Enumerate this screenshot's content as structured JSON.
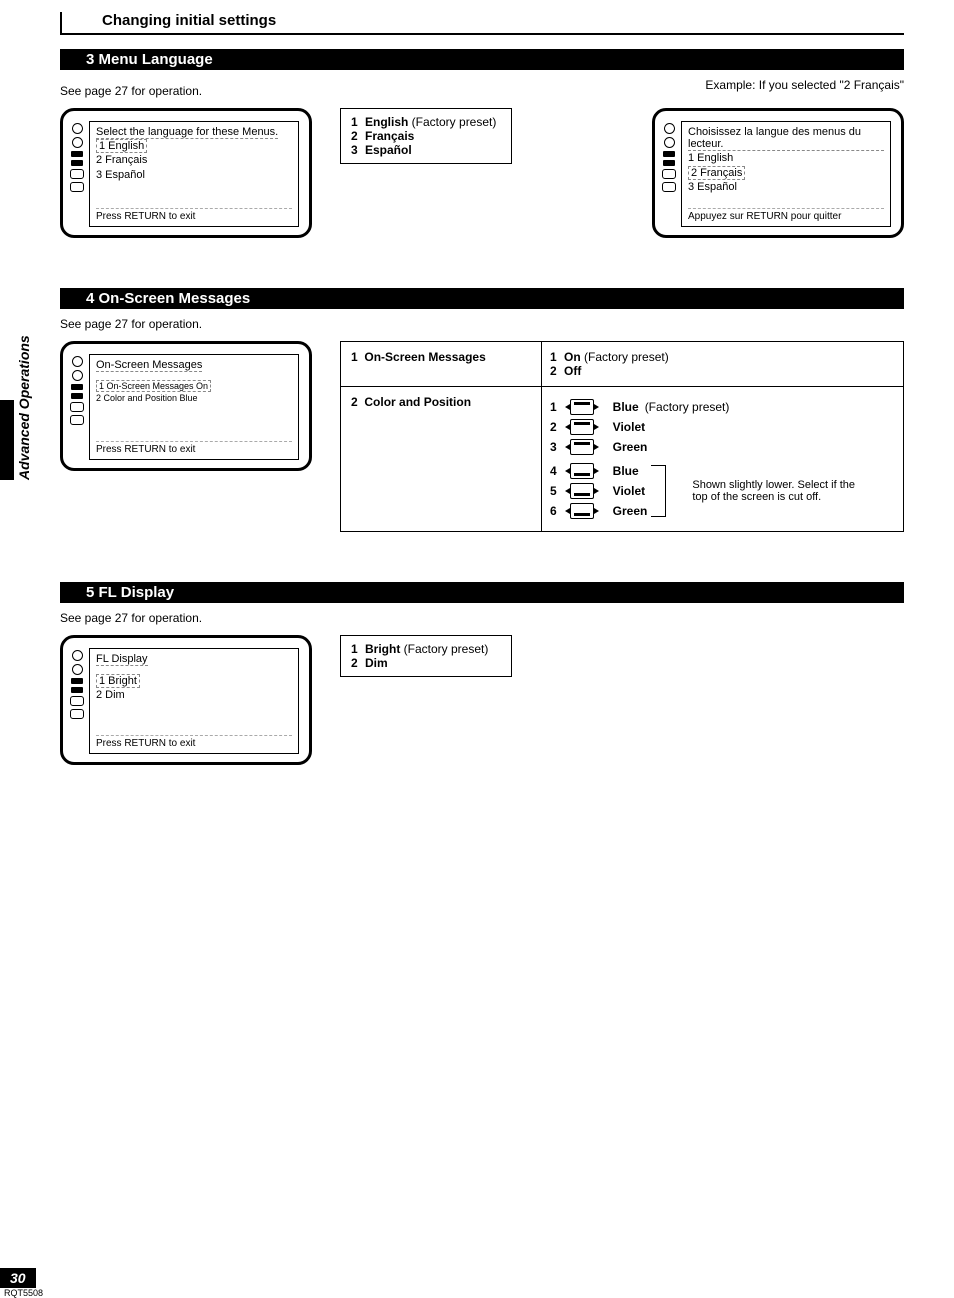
{
  "header": {
    "title": "Changing initial settings"
  },
  "side_label": "Advanced Operations",
  "page_number": "30",
  "doc_code": "RQT5508",
  "sec3": {
    "bar": "3 Menu Language",
    "see": "See page 27 for operation.",
    "tv1": {
      "heading": "Select the language for these Menus.",
      "items": [
        "1  English",
        "2  Français",
        "3  Español"
      ],
      "footer": "Press RETURN to exit"
    },
    "options": [
      {
        "num": "1",
        "label": "English",
        "note": " (Factory preset)"
      },
      {
        "num": "2",
        "label": "Français",
        "note": ""
      },
      {
        "num": "3",
        "label": "Español",
        "note": ""
      }
    ],
    "example_text": "Example: If you selected \"2 Français\"",
    "tv2": {
      "heading": "Choisissez la langue des menus du lecteur.",
      "items": [
        "1  English",
        "2  Français",
        "3  Español"
      ],
      "footer": "Appuyez sur RETURN pour quitter"
    }
  },
  "sec4": {
    "bar": "4 On-Screen Messages",
    "see": "See page 27 for operation.",
    "tv": {
      "heading": "On-Screen Messages",
      "items": [
        "1 On-Screen Messages   On",
        "2 Color and Position        Blue"
      ],
      "footer": "Press RETURN to exit"
    },
    "table": {
      "row1": {
        "left_num": "1",
        "left_label": "On-Screen Messages",
        "opts": [
          {
            "num": "1",
            "label": "On",
            "note": " (Factory preset)"
          },
          {
            "num": "2",
            "label": "Off",
            "note": ""
          }
        ]
      },
      "row2": {
        "left_num": "2",
        "left_label": "Color and Position",
        "colors": [
          {
            "num": "1",
            "label": "Blue",
            "note": " (Factory preset)",
            "pos": "top"
          },
          {
            "num": "2",
            "label": "Violet",
            "note": "",
            "pos": "top"
          },
          {
            "num": "3",
            "label": "Green",
            "note": "",
            "pos": "top"
          },
          {
            "num": "4",
            "label": "Blue",
            "note": "",
            "pos": "bot"
          },
          {
            "num": "5",
            "label": "Violet",
            "note": "",
            "pos": "bot"
          },
          {
            "num": "6",
            "label": "Green",
            "note": "",
            "pos": "bot"
          }
        ],
        "side_note": "Shown slightly lower. Select if the top of the screen is cut off."
      }
    }
  },
  "sec5": {
    "bar": "5 FL Display",
    "see": "See page 27 for operation.",
    "tv": {
      "heading": "FL Display",
      "items": [
        "1 Bright",
        "2 Dim"
      ],
      "footer": "Press RETURN to exit"
    },
    "options": [
      {
        "num": "1",
        "label": "Bright",
        "note": " (Factory preset)"
      },
      {
        "num": "2",
        "label": "Dim",
        "note": ""
      }
    ]
  }
}
